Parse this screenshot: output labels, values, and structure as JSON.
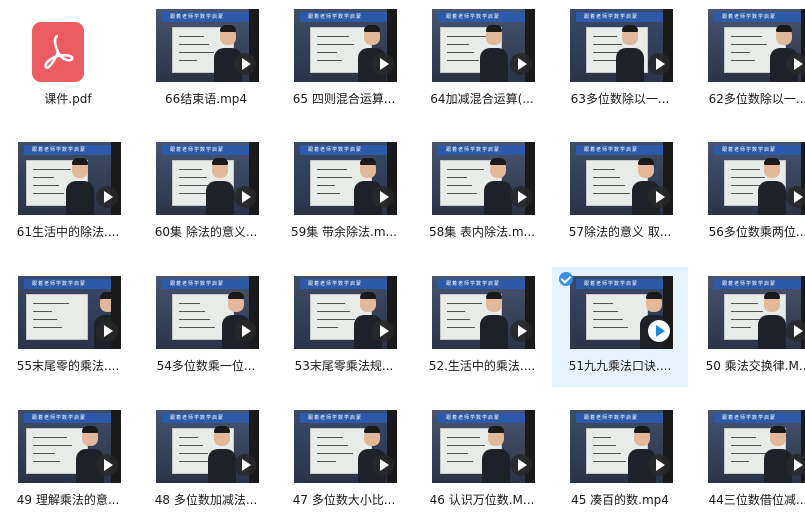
{
  "files": [
    {
      "name": "课件.pdf",
      "type": "pdf"
    },
    {
      "name": "66结束语.mp4",
      "type": "video"
    },
    {
      "name": "65 四则混合运算...",
      "type": "video"
    },
    {
      "name": "64加减混合运算(...",
      "type": "video"
    },
    {
      "name": "63多位数除以一...",
      "type": "video"
    },
    {
      "name": "62多位数除以一...",
      "type": "video"
    },
    {
      "name": "61生活中的除法....",
      "type": "video"
    },
    {
      "name": "60集 除法的意义...",
      "type": "video"
    },
    {
      "name": "59集 带余除法.m...",
      "type": "video"
    },
    {
      "name": "58集 表内除法.m...",
      "type": "video"
    },
    {
      "name": "57除法的意义 取...",
      "type": "video"
    },
    {
      "name": "56多位数乘两位...",
      "type": "video"
    },
    {
      "name": "55末尾零的乘法....",
      "type": "video"
    },
    {
      "name": "54多位数乘一位...",
      "type": "video"
    },
    {
      "name": "53末尾零乘法规...",
      "type": "video"
    },
    {
      "name": "52.生活中的乘法....",
      "type": "video"
    },
    {
      "name": "51九九乘法口诀....",
      "type": "video",
      "selected": true
    },
    {
      "name": "50 乘法交换律.M...",
      "type": "video"
    },
    {
      "name": "49 理解乘法的意...",
      "type": "video"
    },
    {
      "name": "48 多位数加减法...",
      "type": "video"
    },
    {
      "name": "47 多位数大小比...",
      "type": "video"
    },
    {
      "name": "46 认识万位数.M...",
      "type": "video"
    },
    {
      "name": "45 凑百的数.mp4",
      "type": "video"
    },
    {
      "name": "44三位数借位减...",
      "type": "video"
    }
  ],
  "banner_text": "跟着老师学数学启蒙",
  "colors": {
    "pdf_icon": "#ec5b62",
    "selected_bg": "#e5f3ff",
    "check": "#3d8ee9",
    "banner": "#2c5aa8"
  },
  "icons": {
    "pdf": "pdf-icon",
    "play": "play-icon",
    "check": "check-icon"
  }
}
